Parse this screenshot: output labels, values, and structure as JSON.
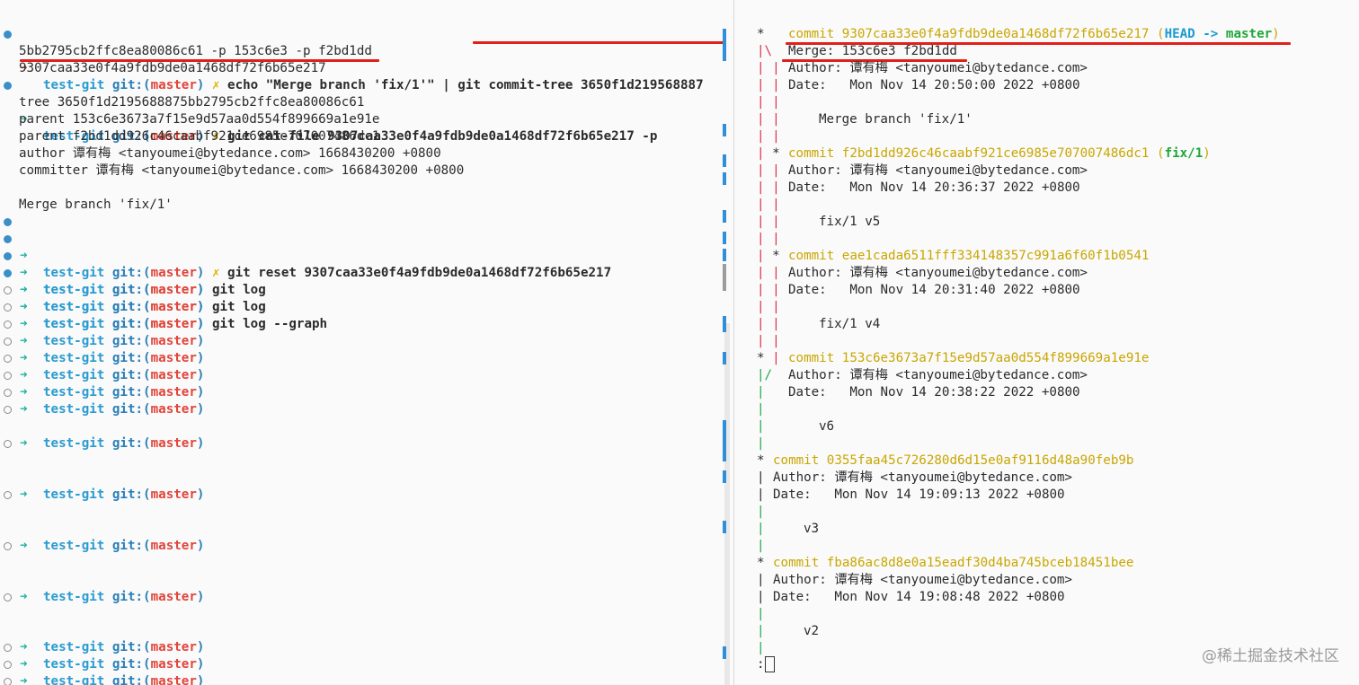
{
  "prompt": {
    "dir": "test-git",
    "git_label": "git:(",
    "branch": "master",
    "close": ")",
    "x_mark": "✗",
    "arrow": "➜"
  },
  "left": {
    "cmd1": "echo \"Merge branch 'fix/1'\" | ",
    "cmd1b": "git commit-tree 3650f1d219568887",
    "cmd1_wrap": "5bb2795cb2ffc8ea80086c61 -p 153c6e3 -p f2bd1dd",
    "out1": "9307caa33e0f4a9fdb9de0a1468df72f6b65e217",
    "cmd2": "git cat-file 9307caa33e0f4a9fdb9de0a1468df72f6b65e217 -p",
    "catfile": [
      "tree 3650f1d2195688875bb2795cb2ffc8ea80086c61",
      "parent 153c6e3673a7f15e9d57aa0d554f899669a1e91e",
      "parent f2bd1dd926c46caabf921ce6985e707007486dc1",
      "author 谭有梅 <tanyoumei@bytedance.com> 1668430200 +0800",
      "committer 谭有梅 <tanyoumei@bytedance.com> 1668430200 +0800",
      "",
      "Merge branch 'fix/1'"
    ],
    "cmd3": "git reset 9307caa33e0f4a9fdb9de0a1468df72f6b65e217",
    "cmd4": "git log",
    "cmd5": "git log",
    "cmd6": "git log --graph"
  },
  "right": {
    "c1_hash": "commit 9307caa33e0f4a9fdb9de0a1468df72f6b65e217",
    "c1_ref_open": "(",
    "c1_head": "HEAD -> ",
    "c1_master": "master",
    "c1_ref_close": ")",
    "c1_merge": "Merge: 153c6e3 f2bd1dd",
    "c1_author": "Author: 谭有梅 <tanyoumei@bytedance.com>",
    "c1_date": "Date:   Mon Nov 14 20:50:00 2022 +0800",
    "c1_msg": "Merge branch 'fix/1'",
    "c2_hash": "commit f2bd1dd926c46caabf921ce6985e707007486dc1",
    "c2_ref_open": "(",
    "c2_ref": "fix/1",
    "c2_ref_close": ")",
    "c2_author": "Author: 谭有梅 <tanyoumei@bytedance.com>",
    "c2_date": "Date:   Mon Nov 14 20:36:37 2022 +0800",
    "c2_msg": "fix/1 v5",
    "c3_hash": "commit eae1cada6511fff334148357c991a6f60f1b0541",
    "c3_author": "Author: 谭有梅 <tanyoumei@bytedance.com>",
    "c3_date": "Date:   Mon Nov 14 20:31:40 2022 +0800",
    "c3_msg": "fix/1 v4",
    "c4_hash": "commit 153c6e3673a7f15e9d57aa0d554f899669a1e91e",
    "c4_author": "Author: 谭有梅 <tanyoumei@bytedance.com>",
    "c4_date": "Date:   Mon Nov 14 20:38:22 2022 +0800",
    "c4_msg": "v6",
    "c5_hash": "commit 0355faa45c726280d6d15e0af9116d48a90feb9b",
    "c5_author": "Author: 谭有梅 <tanyoumei@bytedance.com>",
    "c5_date": "Date:   Mon Nov 14 19:09:13 2022 +0800",
    "c5_msg": "v3",
    "c6_hash": "commit fba86ac8d8e0a15eadf30d4ba745bceb18451bee",
    "c6_author": "Author: 谭有梅 <tanyoumei@bytedance.com>",
    "c6_date": "Date:   Mon Nov 14 19:08:48 2022 +0800",
    "c6_msg": "v2",
    "pager_prompt": ":"
  },
  "watermark": "@稀土掘金技术社区",
  "colors": {
    "accent_blue": "#2a9bd0",
    "branch_red": "#e0463c",
    "commit_yellow": "#c9a600",
    "graph_green": "#21a84c",
    "underline_red": "#e0201a"
  }
}
